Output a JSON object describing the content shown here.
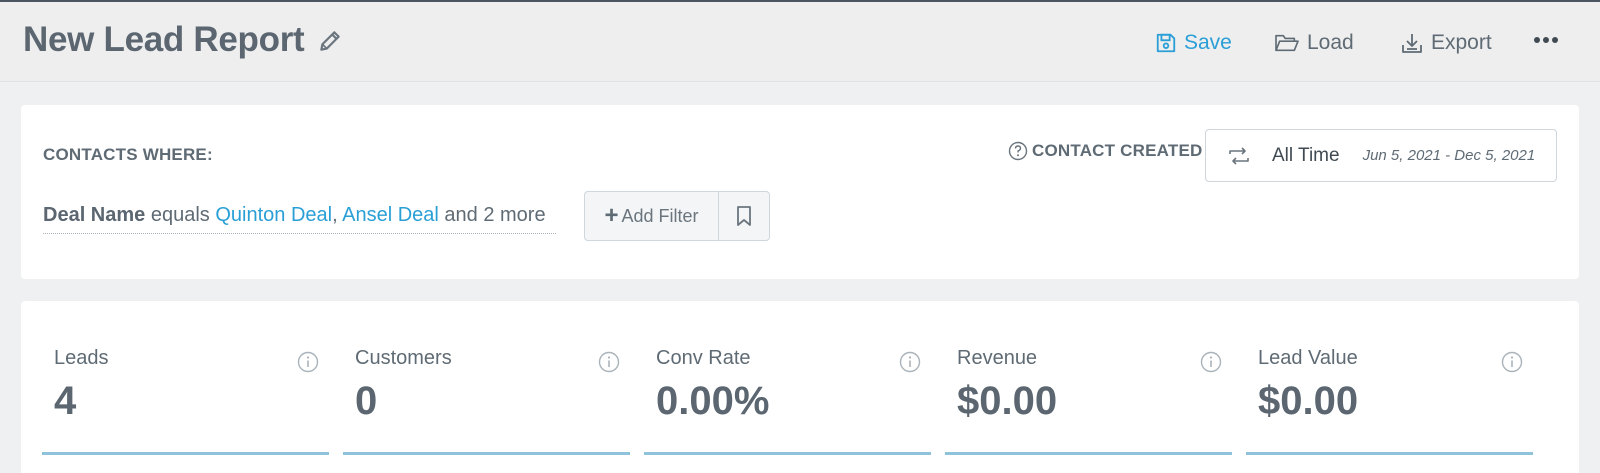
{
  "header": {
    "title": "New Lead Report",
    "save_label": "Save",
    "load_label": "Load",
    "export_label": "Export",
    "accent_color": "#2a9fd6"
  },
  "filters": {
    "contacts_where_label": "CONTACTS WHERE:",
    "field": "Deal Name",
    "operator": "equals",
    "value_1": "Quinton Deal",
    "separator": ",",
    "value_2": "Ansel Deal",
    "more_text": "and 2 more",
    "add_filter_label": "Add Filter",
    "contact_created_label": "CONTACT CREATED",
    "range_label": "All Time",
    "range_dates": "Jun 5, 2021 - Dec 5, 2021"
  },
  "stats": [
    {
      "label": "Leads",
      "value": "4"
    },
    {
      "label": "Customers",
      "value": "0"
    },
    {
      "label": "Conv Rate",
      "value": "0.00%"
    },
    {
      "label": "Revenue",
      "value": "$0.00"
    },
    {
      "label": "Lead Value",
      "value": "$0.00"
    }
  ],
  "icons": {
    "pencil": "pencil-icon",
    "save": "floppy-disk-icon",
    "load": "folder-open-icon",
    "export": "download-tray-icon",
    "more": "more-horizontal-icon",
    "help": "question-circle-icon",
    "swap": "swap-arrows-icon",
    "bookmark": "bookmark-icon",
    "info": "info-circle-icon"
  }
}
